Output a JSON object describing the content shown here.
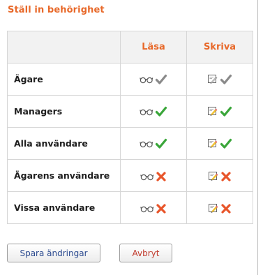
{
  "title": "Ställ in behörighet",
  "columns": {
    "read": "Läsa",
    "write": "Skriva"
  },
  "rows": [
    {
      "role": "Ägare",
      "read": "allowed-locked",
      "write": "allowed-locked"
    },
    {
      "role": "Managers",
      "read": "allowed",
      "write": "allowed"
    },
    {
      "role": "Alla användare",
      "read": "allowed",
      "write": "allowed"
    },
    {
      "role": "Ägarens användare",
      "read": "denied",
      "write": "denied"
    },
    {
      "role": "Vissa användare",
      "read": "denied",
      "write": "denied"
    }
  ],
  "buttons": {
    "save": "Spara ändringar",
    "cancel": "Avbryt"
  },
  "colors": {
    "accent": "#e8692a",
    "allowed": "#3aa63a",
    "locked": "#8a8a8a",
    "denied": "#e8552a"
  }
}
